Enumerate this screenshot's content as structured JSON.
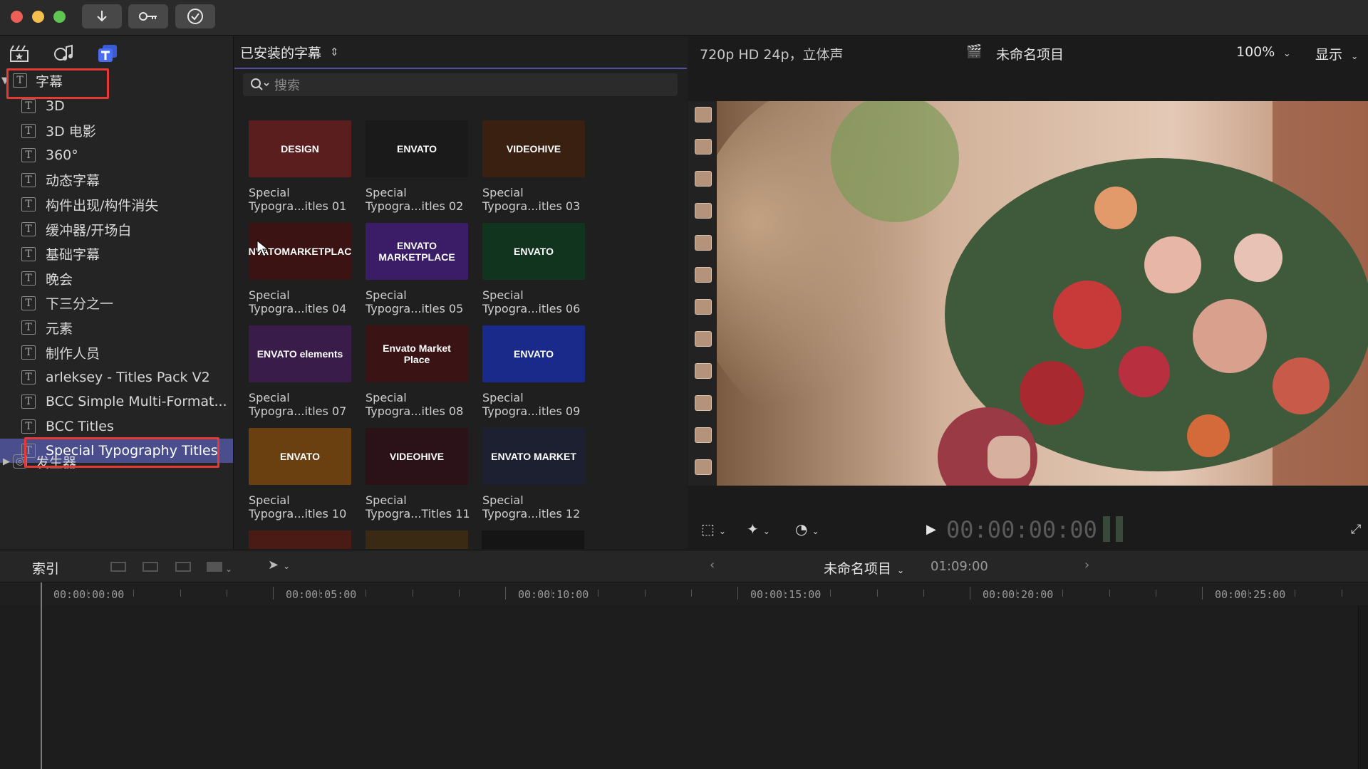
{
  "toolbar": {
    "buttons": [
      "import-icon",
      "key-icon",
      "checkmark-icon"
    ]
  },
  "sidebar": {
    "tools": [
      "clapper-star-icon",
      "music-photo-icon",
      "titles-icon"
    ],
    "root": {
      "label": "字幕",
      "expanded": true
    },
    "items": [
      "3D",
      "3D 电影",
      "360°",
      "动态字幕",
      "构件出现/构件消失",
      "缓冲器/开场白",
      "基础字幕",
      "晚会",
      "下三分之一",
      "元素",
      "制作人员",
      "arleksey - Titles Pack V2",
      "BCC Simple Multi-Format...",
      "BCC Titles",
      "Special Typography Titles"
    ],
    "selected_index": 14,
    "generators": {
      "label": "发生器",
      "expanded": false
    }
  },
  "browser": {
    "header": "已安装的字幕",
    "search_placeholder": "搜索",
    "tiles": [
      {
        "thumb_text": "DESIGN",
        "line1": "Special",
        "line2": "Typogra...itles 01",
        "bg": "#5a1e1e"
      },
      {
        "thumb_text": "ENVATO",
        "line1": "Special",
        "line2": "Typogra...itles 02",
        "bg": "#1a1a1a"
      },
      {
        "thumb_text": "VIDEOHIVE",
        "line1": "Special",
        "line2": "Typogra...itles 03",
        "bg": "#3a2010"
      },
      {
        "thumb_text": "ENVATOMARKETPLACE",
        "line1": "Special",
        "line2": "Typogra...itles 04",
        "bg": "#3b1313"
      },
      {
        "thumb_text": "ENVATO MARKETPLACE",
        "line1": "Special",
        "line2": "Typogra...itles 05",
        "bg": "#3a1d66"
      },
      {
        "thumb_text": "ENVATO",
        "line1": "Special",
        "line2": "Typogra...itles 06",
        "bg": "#10341e"
      },
      {
        "thumb_text": "ENVATO elements",
        "line1": "Special",
        "line2": "Typogra...itles 07",
        "bg": "#3a1c4a"
      },
      {
        "thumb_text": "Envato Market Place",
        "line1": "Special",
        "line2": "Typogra...itles 08",
        "bg": "#3a1414"
      },
      {
        "thumb_text": "ENVATO",
        "line1": "Special",
        "line2": "Typogra...itles 09",
        "bg": "#1a2a8a"
      },
      {
        "thumb_text": "ENVATO",
        "line1": "Special",
        "line2": "Typogra...itles 10",
        "bg": "#6a4010"
      },
      {
        "thumb_text": "VIDEOHIVE",
        "line1": "Special",
        "line2": "Typogra...Titles 11",
        "bg": "#2a1218"
      },
      {
        "thumb_text": "ENVATO MARKET",
        "line1": "Special",
        "line2": "Typogra...itles 12",
        "bg": "#1c2030"
      }
    ]
  },
  "viewer": {
    "format": "720p HD 24p，立体声",
    "project": "未命名项目",
    "zoom": "100%",
    "display": "显示",
    "timecode": "00:00:00:00"
  },
  "timeline": {
    "index_label": "索引",
    "project": "未命名项目",
    "duration": "01:09:00",
    "ruler": [
      "00:00:00:00",
      "00:00:05:00",
      "00:00:10:00",
      "00:00:15:00",
      "00:00:20:00",
      "00:00:25:00"
    ]
  },
  "colors": {
    "selection": "#4a4e8c",
    "highlight_box": "#e53935",
    "accent_line": "#4e52a0"
  }
}
